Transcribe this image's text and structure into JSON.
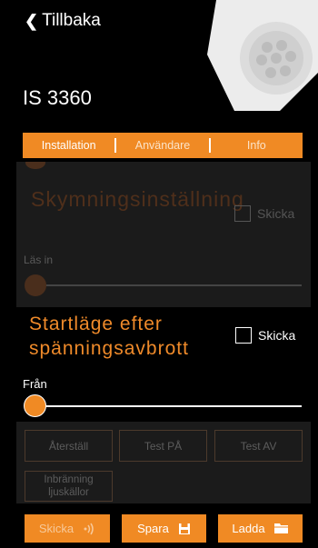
{
  "header": {
    "back_label": "Tillbaka",
    "title": "IS 3360"
  },
  "tabs": [
    {
      "label": "Installation",
      "active": true
    },
    {
      "label": "Användare",
      "active": false
    },
    {
      "label": "Info",
      "active": false
    }
  ],
  "twilight": {
    "title": "Skymningsinställning",
    "send_label": "Skicka",
    "send_checked": false,
    "read_label": "Läs in",
    "enabled": false
  },
  "startup": {
    "title": "Startläge efter spänningsavbrott",
    "send_label": "Skicka",
    "send_checked": false,
    "value_label": "Från",
    "slider_value": 0
  },
  "actions": {
    "reset_label": "Återställ",
    "test_on_label": "Test PÅ",
    "test_off_label": "Test AV",
    "burn_in_label": "Inbränning ljuskällor"
  },
  "bottom": {
    "send_label": "Skicka",
    "save_label": "Spara",
    "load_label": "Ladda"
  },
  "colors": {
    "accent": "#f08a24",
    "background": "#000000",
    "disabled_panel": "#1b1b1b"
  },
  "icons": {
    "back": "chevron-left-icon",
    "send": "signal-icon",
    "save": "floppy-disk-icon",
    "load": "folder-icon"
  }
}
